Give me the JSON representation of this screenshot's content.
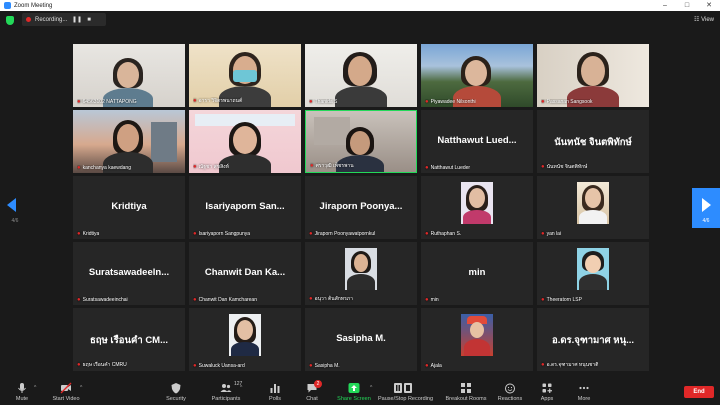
{
  "window": {
    "title": "Zoom Meeting"
  },
  "recording": {
    "label": "Recording..."
  },
  "view": {
    "label": "View"
  },
  "pagination": {
    "left": "4/6",
    "right": "4/6"
  },
  "participants": [
    {
      "name": "64563102 NATTAPONG",
      "display": "",
      "type": "video"
    },
    {
      "name": "อารา วิจิตรพนาถนต์",
      "display": "",
      "type": "video"
    },
    {
      "name": "Thanida S",
      "display": "",
      "type": "video"
    },
    {
      "name": "Piyawadee Nilsonthi",
      "display": "",
      "type": "video"
    },
    {
      "name": "Passanan Sangsook",
      "display": "",
      "type": "video"
    },
    {
      "name": "kanchanya kaewdang",
      "display": "",
      "type": "video"
    },
    {
      "name": "ณัฐชา สุขสิงห์",
      "display": "",
      "type": "video"
    },
    {
      "name": "ศราวุฒิ เพ็ชรพาน",
      "display": "",
      "type": "video"
    },
    {
      "name": "Natthawut Lueder",
      "display": "Natthawut Lued...",
      "type": "name"
    },
    {
      "name": "นันทนัช จินตพิทักษ์",
      "display": "นันทนัช จินตพิทักษ์",
      "type": "name"
    },
    {
      "name": "Kridtiya",
      "display": "Kridtiya",
      "type": "name"
    },
    {
      "name": "Isariyaporn Sangpunya",
      "display": "Isariyaporn San...",
      "type": "name"
    },
    {
      "name": "Jiraporn Poonyawatpornkul",
      "display": "Jiraporn Poonya...",
      "type": "name"
    },
    {
      "name": "Ruthaphan S.",
      "display": "",
      "type": "photo"
    },
    {
      "name": "yan lai",
      "display": "",
      "type": "photo"
    },
    {
      "name": "Suratsawadeeinchai",
      "display": "Suratsawadeeln...",
      "type": "name"
    },
    {
      "name": "Chanwit Dan Kamcharean",
      "display": "Chanwit Dan Ka...",
      "type": "name"
    },
    {
      "name": "อนุวา ต้นสักทรภา",
      "display": "",
      "type": "photo"
    },
    {
      "name": "min",
      "display": "min",
      "type": "name"
    },
    {
      "name": "Theeratorn LSP",
      "display": "",
      "type": "photo"
    },
    {
      "name": "ธฤษ เรือนคำ CMRU",
      "display": "ธฤษ เรือนคำ CM...",
      "type": "name"
    },
    {
      "name": "Suwaluck Uansa-ard",
      "display": "",
      "type": "photo"
    },
    {
      "name": "Sasipha M.",
      "display": "Sasipha M.",
      "type": "name"
    },
    {
      "name": "Ajala",
      "display": "",
      "type": "photo"
    },
    {
      "name": "อ.ดร.จุฑามาศ หนุนชาติ",
      "display": "อ.ดร.จุฑามาศ หนุ...",
      "type": "name"
    }
  ],
  "toolbar": {
    "mute": "Mute",
    "start_video": "Start Video",
    "security": "Security",
    "participants": "Participants",
    "participants_count": "127",
    "polls": "Polls",
    "chat": "Chat",
    "chat_badge": "2",
    "share_screen": "Share Screen",
    "pause_recording": "Pause/Stop Recording",
    "breakout_rooms": "Breakout Rooms",
    "reactions": "Reactions",
    "apps": "Apps",
    "more": "More",
    "end": "End"
  },
  "colors": {
    "accent": "#2d8cff",
    "share": "#23d959",
    "danger": "#e02828",
    "tile": "#262626"
  }
}
